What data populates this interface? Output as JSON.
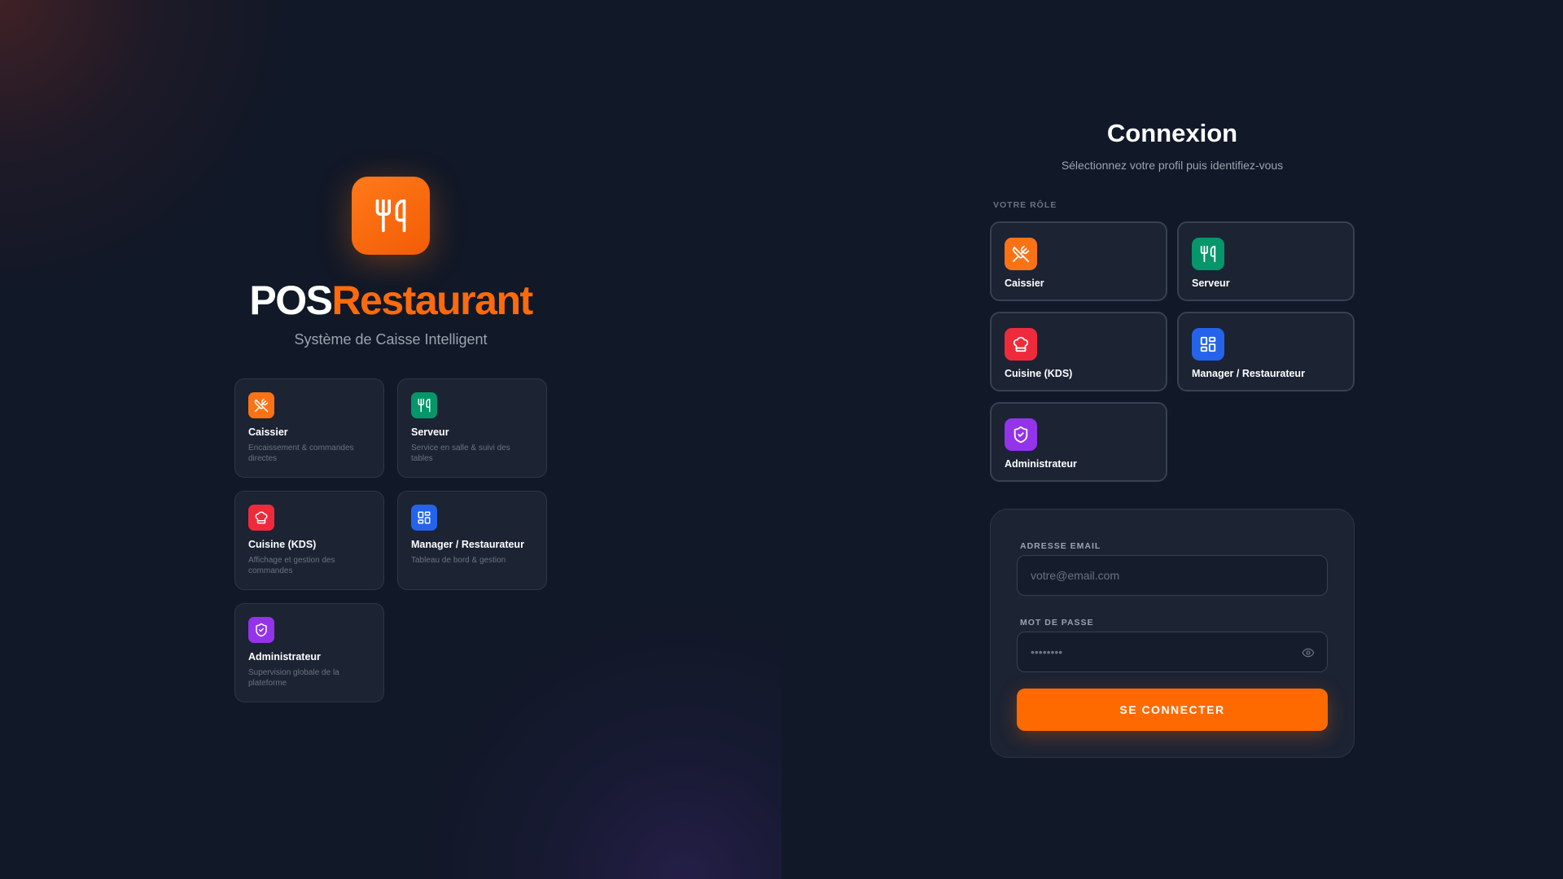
{
  "brand": {
    "name_part1": "POS",
    "name_part2": "Restaurant",
    "subtitle": "Système de Caisse Intelligent",
    "logo_icon": "utensils-icon",
    "accent_color": "#f97316"
  },
  "feature_roles": [
    {
      "label": "Caissier",
      "description": "Encaissement & commandes directes",
      "icon": "utensils-crossed-icon",
      "color": "#f97316"
    },
    {
      "label": "Serveur",
      "description": "Service en salle & suivi des tables",
      "icon": "utensils-icon",
      "color": "#059669"
    },
    {
      "label": "Cuisine (KDS)",
      "description": "Affichage et gestion des commandes",
      "icon": "chef-hat-icon",
      "color": "#ef2b3b"
    },
    {
      "label": "Manager / Restaurateur",
      "description": "Tableau de bord & gestion",
      "icon": "dashboard-icon",
      "color": "#2563eb"
    },
    {
      "label": "Administrateur",
      "description": "Supervision globale de la plateforme",
      "icon": "shield-check-icon",
      "color": "#9333ea"
    }
  ],
  "login": {
    "title": "Connexion",
    "subtitle": "Sélectionnez votre profil puis identifiez-vous",
    "roles_label": "VOTRE RÔLE",
    "roles": [
      {
        "label": "Caissier",
        "icon": "utensils-crossed-icon",
        "color": "#f97316"
      },
      {
        "label": "Serveur",
        "icon": "utensils-icon",
        "color": "#059669"
      },
      {
        "label": "Cuisine (KDS)",
        "icon": "chef-hat-icon",
        "color": "#ef2b3b"
      },
      {
        "label": "Manager / Restaurateur",
        "icon": "dashboard-icon",
        "color": "#2563eb"
      },
      {
        "label": "Administrateur",
        "icon": "shield-check-icon",
        "color": "#9333ea"
      }
    ],
    "email_label": "ADRESSE EMAIL",
    "email_placeholder": "votre@email.com",
    "email_value": "",
    "password_label": "MOT DE PASSE",
    "password_placeholder": "••••••••",
    "password_value": "",
    "password_toggle_icon": "eye-icon",
    "submit_label": "SE CONNECTER"
  }
}
